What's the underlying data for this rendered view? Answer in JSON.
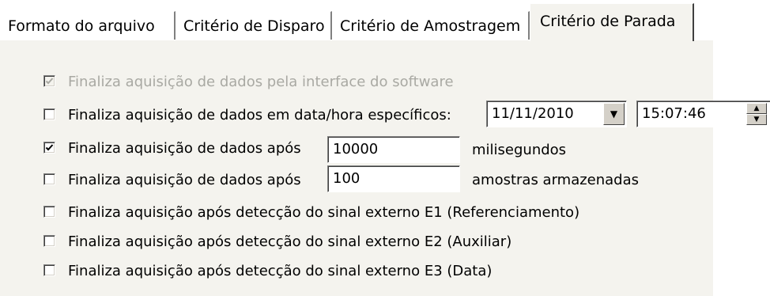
{
  "tabs": [
    {
      "label": "Formato do arquivo",
      "active": false
    },
    {
      "label": "Critério de Disparo",
      "active": false
    },
    {
      "label": "Critério de Amostragem",
      "active": false
    },
    {
      "label": "Critério de Parada",
      "active": true
    }
  ],
  "options": {
    "software_interface": {
      "label": "Finaliza aquisição de dados pela interface do software",
      "checked": true,
      "enabled": false
    },
    "datetime": {
      "label": "Finaliza aquisição de dados em data/hora específicos:",
      "checked": false,
      "date": "11/11/2010",
      "time": "15:07:46"
    },
    "after_ms": {
      "label": "Finaliza aquisição de dados após",
      "checked": true,
      "value": "10000",
      "unit": "milisegundos"
    },
    "after_samples": {
      "label": "Finaliza aquisição de dados após",
      "checked": false,
      "value": "100",
      "unit": "amostras armazenadas"
    },
    "signal_e1": {
      "label": "Finaliza aquisição após detecção do sinal externo E1 (Referenciamento)",
      "checked": false
    },
    "signal_e2": {
      "label": "Finaliza aquisição após detecção do sinal externo E2 (Auxiliar)",
      "checked": false
    },
    "signal_e3": {
      "label": "Finaliza aquisição após detecção do sinal externo E3 (Data)",
      "checked": false
    }
  },
  "icons": {
    "checkmark": "check-icon",
    "dropdown": "chevron-down-icon",
    "spin_up": "spin-up-icon",
    "spin_down": "spin-down-icon"
  },
  "colors": {
    "panel_background": "#f4f3ee",
    "disabled_text": "#a9a9a3"
  }
}
